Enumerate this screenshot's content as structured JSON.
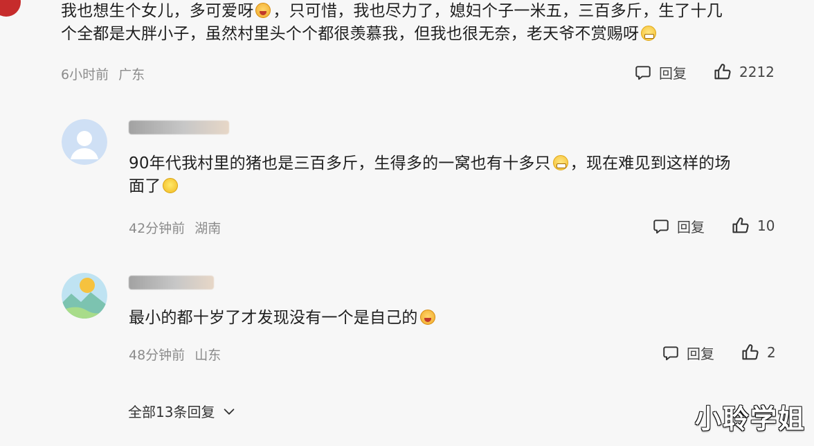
{
  "comment1": {
    "line1_a": "我也想生个女儿，多可爱呀",
    "line1_b": "，只可惜，我也尽力了，媳妇个子一米五，三百多斤，生了十几",
    "line2": "个全都是大胖小子，虽然村里头个个都很羡慕我，但我也很无奈，老天爷不赏赐呀",
    "time": "6小时前",
    "location": "广东",
    "reply_label": "回复",
    "likes": "2212"
  },
  "comment2": {
    "line1_a": "90年代我村里的猪也是三百多斤，生得多的一窝也有十多只",
    "line1_b": "，现在难见到这样的场",
    "line2": "面了",
    "time": "42分钟前",
    "location": "湖南",
    "reply_label": "回复",
    "likes": "10"
  },
  "comment3": {
    "text": "最小的都十岁了才发现没有一个是自己的",
    "time": "48分钟前",
    "location": "山东",
    "reply_label": "回复",
    "likes": "2"
  },
  "expand_label": "全部13条回复",
  "watermark": "小聆学姐",
  "icons": {
    "reply": "comment-bubble-icon",
    "like": "thumbs-up-icon",
    "expand": "chevron-down-icon"
  }
}
